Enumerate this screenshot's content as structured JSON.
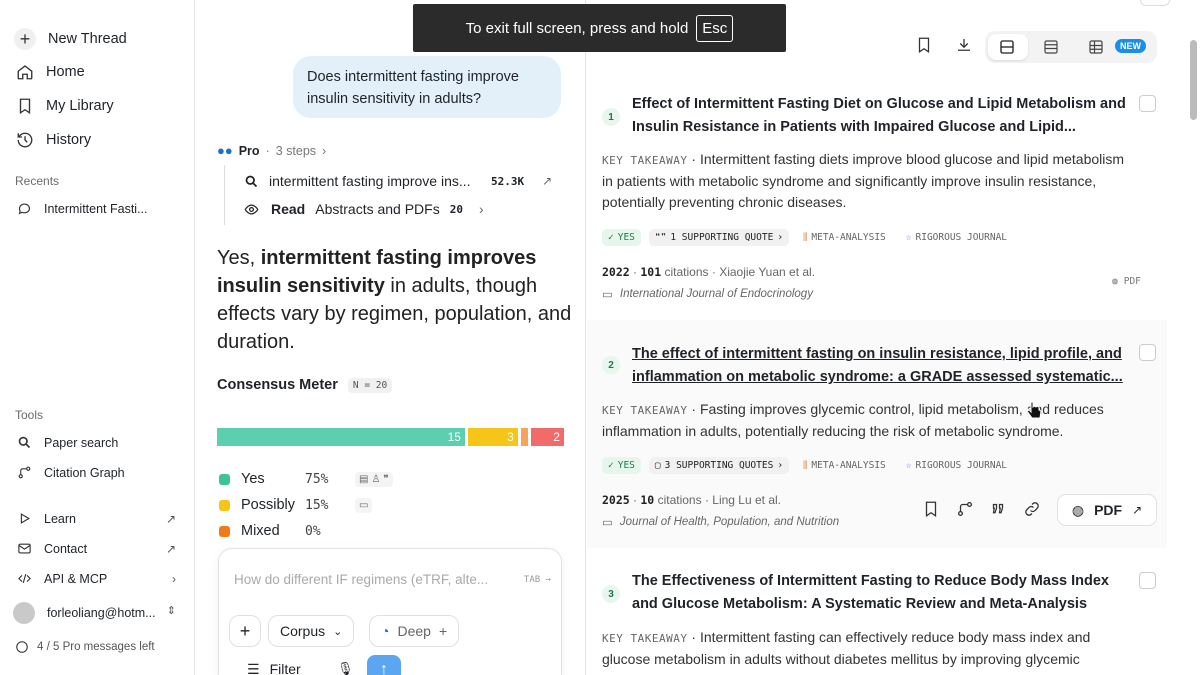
{
  "sidebar": {
    "new_thread": "New Thread",
    "home": "Home",
    "library": "My Library",
    "history": "History",
    "recents_label": "Recents",
    "recent_item": "Intermittent Fasti...",
    "tools_label": "Tools",
    "paper_search": "Paper search",
    "citation_graph": "Citation Graph",
    "learn": "Learn",
    "contact": "Contact",
    "api": "API & MCP",
    "account": "forleoliang@hotm...",
    "pro_left": "4 / 5 Pro messages left"
  },
  "thread": {
    "question": "Does intermittent fasting improve insulin sensitivity in adults?",
    "pro_label": "Pro",
    "steps": "3 steps",
    "step1_text": "intermittent fasting improve ins...",
    "step1_count": "52.3K",
    "step2_bold": "Read",
    "step2_text": "Abstracts and PDFs",
    "step2_count": "20",
    "answer_lead": "Yes, ",
    "answer_bold": "intermittent fasting improves insulin sensitivity",
    "answer_rest": " in adults, though effects vary by regimen, population, and duration."
  },
  "consensus": {
    "title": "Consensus Meter",
    "n_label": "N = 20",
    "segments": [
      {
        "label": "15",
        "fraction": 0.75,
        "color": "#5ccfb0"
      },
      {
        "label": "3",
        "fraction": 0.15,
        "color": "#f5c518"
      },
      {
        "label": "",
        "fraction": 0.02,
        "color": "#f7a35c"
      },
      {
        "label": "2",
        "fraction": 0.1,
        "color": "#f26b6b"
      }
    ],
    "legend": [
      {
        "name": "Yes",
        "pct": "75%",
        "color": "#3cc39a"
      },
      {
        "name": "Possibly",
        "pct": "15%",
        "color": "#f5c518"
      },
      {
        "name": "Mixed",
        "pct": "0%",
        "color": "#f07a1a"
      }
    ]
  },
  "composer": {
    "placeholder": "How do different IF regimens (eTRF, alte...",
    "tab_hint": "TAB →",
    "corpus": "Corpus",
    "deep": "Deep",
    "filter": "Filter"
  },
  "toast": {
    "text": "To exit full screen, press and hold",
    "key": "Esc"
  },
  "toolbar": {
    "new_badge": "NEW"
  },
  "papers": [
    {
      "num": "1",
      "title": "Effect of Intermittent Fasting Diet on Glucose and Lipid Metabolism and Insulin Resistance in Patients with Impaired Glucose and Lipid...",
      "key_takeaway_label": "KEY TAKEAWAY",
      "takeaway": "Intermittent fasting diets improve blood glucose and lipid metabolism in patients with metabolic syndrome and significantly improve insulin resistance, potentially preventing chronic diseases.",
      "yes": "YES",
      "quotes": "1 SUPPORTING QUOTE",
      "design": "META-ANALYSIS",
      "journal_tag": "RIGOROUS JOURNAL",
      "year": "2022",
      "citations_num": "101",
      "citations_label": "citations",
      "authors": "Xiaojie Yuan et al.",
      "journal": "International Journal of Endocrinology",
      "pdf": "PDF"
    },
    {
      "num": "2",
      "title": "The effect of intermittent fasting on insulin resistance, lipid profile, and inflammation on metabolic syndrome: a GRADE assessed systematic...",
      "key_takeaway_label": "KEY TAKEAWAY",
      "takeaway": "Fasting improves glycemic control, lipid metabolism, and reduces inflammation in adults, potentially reducing the risk of metabolic syndrome.",
      "yes": "YES",
      "quotes": "3 SUPPORTING QUOTES",
      "design": "META-ANALYSIS",
      "journal_tag": "RIGOROUS JOURNAL",
      "year": "2025",
      "citations_num": "10",
      "citations_label": "citations",
      "authors": "Ling Lu et al.",
      "journal": "Journal of Health, Population, and Nutrition",
      "pdf": "PDF"
    },
    {
      "num": "3",
      "title": "The Effectiveness of Intermittent Fasting to Reduce Body Mass Index and Glucose Metabolism: A Systematic Review and Meta-Analysis",
      "key_takeaway_label": "KEY TAKEAWAY",
      "takeaway": "Intermittent fasting can effectively reduce body mass index and glucose metabolism in adults without diabetes mellitus by improving glycemic"
    }
  ]
}
